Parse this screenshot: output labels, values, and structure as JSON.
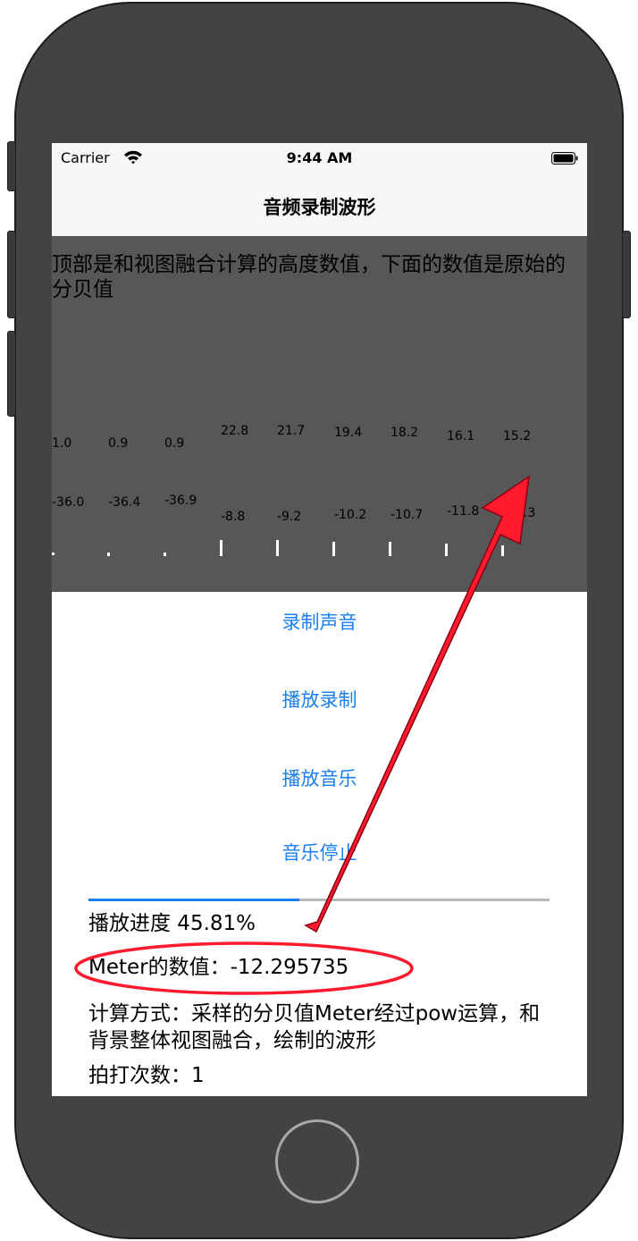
{
  "status_bar": {
    "carrier": "Carrier",
    "time": "9:44 AM"
  },
  "nav": {
    "title": "音频录制波形"
  },
  "waveform": {
    "description": "顶部是和视图融合计算的高度数值，下面的数值是原始的分贝值",
    "items": [
      {
        "top": "1.0",
        "bottom": "-36.0"
      },
      {
        "top": "0.9",
        "bottom": "-36.4"
      },
      {
        "top": "0.9",
        "bottom": "-36.9"
      },
      {
        "top": "22.8",
        "bottom": "-8.8"
      },
      {
        "top": "21.7",
        "bottom": "-9.2"
      },
      {
        "top": "19.4",
        "bottom": "-10.2"
      },
      {
        "top": "18.2",
        "bottom": "-10.7"
      },
      {
        "top": "16.1",
        "bottom": "-11.8"
      },
      {
        "top": "15.2",
        "bottom": "-12.3"
      }
    ]
  },
  "buttons": {
    "record": "录制声音",
    "play_recording": "播放录制",
    "play_music": "播放音乐",
    "stop_music": "音乐停止"
  },
  "playback": {
    "progress_fraction": 0.4581,
    "progress_text": "播放进度 45.81%"
  },
  "meter": {
    "text": "Meter的数值：-12.295735"
  },
  "calculation": {
    "text": "计算方式：采样的分贝值Meter经过pow运算，和背景整体视图融合，绘制的波形"
  },
  "tap_count": {
    "text": "拍打次数：1"
  },
  "icons": {
    "wifi": "wifi-icon",
    "battery": "battery-icon",
    "home": "home-button"
  },
  "colors": {
    "accent": "#1a7ff0",
    "annotation": "#ff1a2e",
    "wave_background": "#575757"
  }
}
